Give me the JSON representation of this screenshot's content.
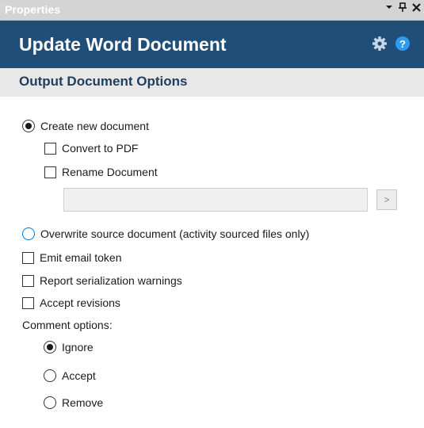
{
  "panel": {
    "title": "Properties",
    "pin_glyph": "ᵼ",
    "close_glyph": "✕"
  },
  "header": {
    "title": "Update Word Document",
    "settings_icon": "gear-icon",
    "help_icon": "question-icon",
    "help_glyph": "?"
  },
  "section": {
    "title": "Output Document Options"
  },
  "options": {
    "create_new": {
      "label": "Create new document",
      "selected": true
    },
    "convert_pdf": {
      "label": "Convert to PDF",
      "checked": false
    },
    "rename": {
      "label": "Rename Document",
      "checked": false
    },
    "rename_value": "",
    "browse_label": ">",
    "overwrite": {
      "label": "Overwrite source document (activity sourced files only)",
      "selected": false
    },
    "emit_email": {
      "label": "Emit email token",
      "checked": false
    },
    "report_serialization": {
      "label": "Report serialization warnings",
      "checked": false
    },
    "accept_revisions": {
      "label": "Accept revisions",
      "checked": false
    }
  },
  "comments": {
    "label": "Comment options:",
    "ignore": {
      "label": "Ignore",
      "selected": true
    },
    "accept": {
      "label": "Accept",
      "selected": false
    },
    "remove": {
      "label": "Remove",
      "selected": false
    }
  },
  "colors": {
    "header_bg": "#1f4e79",
    "section_bg": "#e8e8e8",
    "titlebar_bg": "#d4d4d4",
    "accent_blue": "#0078d7"
  }
}
